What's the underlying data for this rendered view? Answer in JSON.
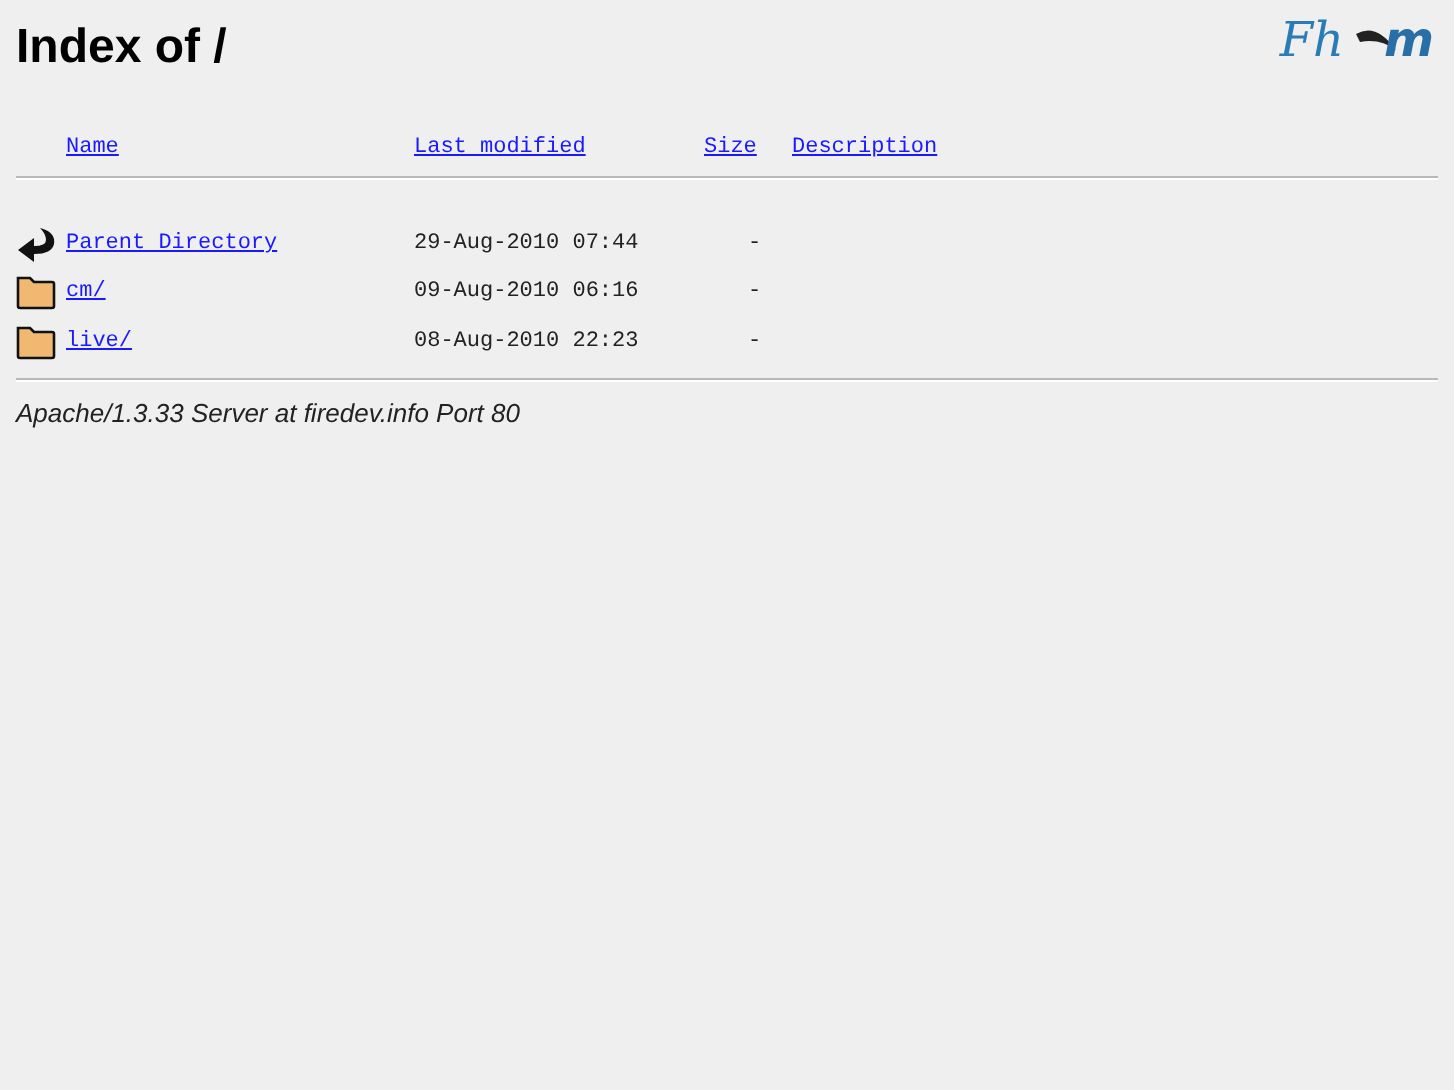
{
  "title": "Index of /",
  "logos": [
    {
      "text": "Fh",
      "kind": "script"
    },
    {
      "text": "m",
      "kind": "bird"
    }
  ],
  "table": {
    "columns": [
      "Name",
      "Last modified",
      "Size",
      "Description"
    ],
    "rows": [
      {
        "kind": "back",
        "name": "Parent Directory",
        "modified": "29-Aug-2010 07:44",
        "size": "-"
      },
      {
        "kind": "folder",
        "name": "cm/",
        "modified": "09-Aug-2010 06:16",
        "size": "-"
      },
      {
        "kind": "folder",
        "name": "live/",
        "modified": "08-Aug-2010 22:23",
        "size": "-"
      }
    ]
  },
  "footer": "Apache/1.3.33 Server at firedev.info Port 80"
}
